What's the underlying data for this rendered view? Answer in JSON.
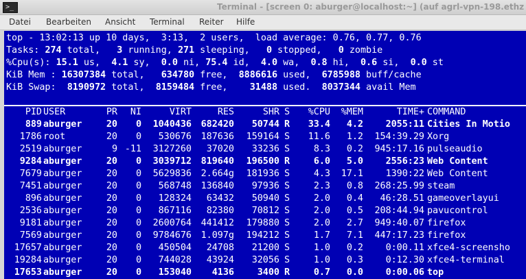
{
  "window": {
    "icon_glyph": ">_",
    "title": "Terminal - [screen 0: aburger@localhost:~]  (auf agrl-vpn-198.ethz"
  },
  "menu": [
    "Datei",
    "Bearbeiten",
    "Ansicht",
    "Terminal",
    "Reiter",
    "Hilfe"
  ],
  "summary": {
    "line1": "top - 13:02:13 up 10 days,  3:13,  2 users,  load average: 0.76, 0.77, 0.76",
    "tasks": {
      "label": "Tasks: ",
      "total": "274",
      "total_lbl": " total,   ",
      "running": "3",
      "running_lbl": " running, ",
      "sleeping": "271",
      "sleeping_lbl": " sleeping,   ",
      "stopped": "0",
      "stopped_lbl": " stopped,   ",
      "zombie": "0",
      "zombie_lbl": " zombie"
    },
    "cpu": {
      "label": "%Cpu(s): ",
      "us": "15.1",
      "us_lbl": " us,  ",
      "sy": "4.1",
      "sy_lbl": " sy,  ",
      "ni": "0.0",
      "ni_lbl": " ni, ",
      "id": "75.4",
      "id_lbl": " id,  ",
      "wa": "4.0",
      "wa_lbl": " wa,  ",
      "hi": "0.8",
      "hi_lbl": " hi,  ",
      "si": "0.6",
      "si_lbl": " si,  ",
      "st": "0.0",
      "st_lbl": " st"
    },
    "mem": {
      "label": "KiB Mem : ",
      "total": "16307384",
      "total_lbl": " total,   ",
      "free": "634780",
      "free_lbl": " free,  ",
      "used": "8886616",
      "used_lbl": " used,  ",
      "buff": "6785988",
      "buff_lbl": " buff/cache"
    },
    "swap": {
      "label": "KiB Swap:  ",
      "total": "8190972",
      "total_lbl": " total,  ",
      "free": "8159484",
      "free_lbl": " free,    ",
      "used": "31488",
      "used_lbl": " used.  ",
      "avail": "8037344",
      "avail_lbl": " avail Mem"
    }
  },
  "columns": [
    "PID",
    "USER",
    "PR",
    "NI",
    "VIRT",
    "RES",
    "SHR",
    "S",
    "%CPU",
    "%MEM",
    "TIME+",
    "COMMAND"
  ],
  "processes": [
    {
      "bold": true,
      "cells": [
        "889",
        "aburger",
        "20",
        "0",
        "1040436",
        "682420",
        "50744",
        "R",
        "33.4",
        "4.2",
        "2055:11",
        "Cities In Motio"
      ]
    },
    {
      "bold": false,
      "cells": [
        "1786",
        "root",
        "20",
        "0",
        "530676",
        "187636",
        "159164",
        "S",
        "11.6",
        "1.2",
        "154:39.29",
        "Xorg"
      ]
    },
    {
      "bold": false,
      "cells": [
        "2519",
        "aburger",
        "9",
        "-11",
        "3127260",
        "37020",
        "33236",
        "S",
        "8.3",
        "0.2",
        "945:17.16",
        "pulseaudio"
      ]
    },
    {
      "bold": true,
      "cells": [
        "9284",
        "aburger",
        "20",
        "0",
        "3039712",
        "819640",
        "196500",
        "R",
        "6.0",
        "5.0",
        "2556:23",
        "Web Content"
      ]
    },
    {
      "bold": false,
      "cells": [
        "7679",
        "aburger",
        "20",
        "0",
        "5629836",
        "2.664g",
        "181936",
        "S",
        "4.3",
        "17.1",
        "1390:22",
        "Web Content"
      ]
    },
    {
      "bold": false,
      "cells": [
        "7451",
        "aburger",
        "20",
        "0",
        "568748",
        "136840",
        "97936",
        "S",
        "2.3",
        "0.8",
        "268:25.99",
        "steam"
      ]
    },
    {
      "bold": false,
      "cells": [
        "896",
        "aburger",
        "20",
        "0",
        "128324",
        "63432",
        "50940",
        "S",
        "2.0",
        "0.4",
        "46:28.51",
        "gameoverlayui"
      ]
    },
    {
      "bold": false,
      "cells": [
        "2536",
        "aburger",
        "20",
        "0",
        "867116",
        "82380",
        "70812",
        "S",
        "2.0",
        "0.5",
        "208:44.94",
        "pavucontrol"
      ]
    },
    {
      "bold": false,
      "cells": [
        "9181",
        "aburger",
        "20",
        "0",
        "2600764",
        "441412",
        "179880",
        "S",
        "2.0",
        "2.7",
        "949:40.07",
        "firefox"
      ]
    },
    {
      "bold": false,
      "cells": [
        "7569",
        "aburger",
        "20",
        "0",
        "9784676",
        "1.097g",
        "194212",
        "S",
        "1.7",
        "7.1",
        "447:17.23",
        "firefox"
      ]
    },
    {
      "bold": false,
      "cells": [
        "17657",
        "aburger",
        "20",
        "0",
        "450504",
        "24708",
        "21200",
        "S",
        "1.0",
        "0.2",
        "0:00.11",
        "xfce4-screensho"
      ]
    },
    {
      "bold": false,
      "cells": [
        "19284",
        "aburger",
        "20",
        "0",
        "744028",
        "43924",
        "32056",
        "S",
        "1.0",
        "0.3",
        "0:12.30",
        "xfce4-terminal"
      ]
    },
    {
      "bold": true,
      "cells": [
        "17653",
        "aburger",
        "20",
        "0",
        "153040",
        "4136",
        "3400",
        "R",
        "0.7",
        "0.0",
        "0:00.06",
        "top"
      ]
    }
  ]
}
